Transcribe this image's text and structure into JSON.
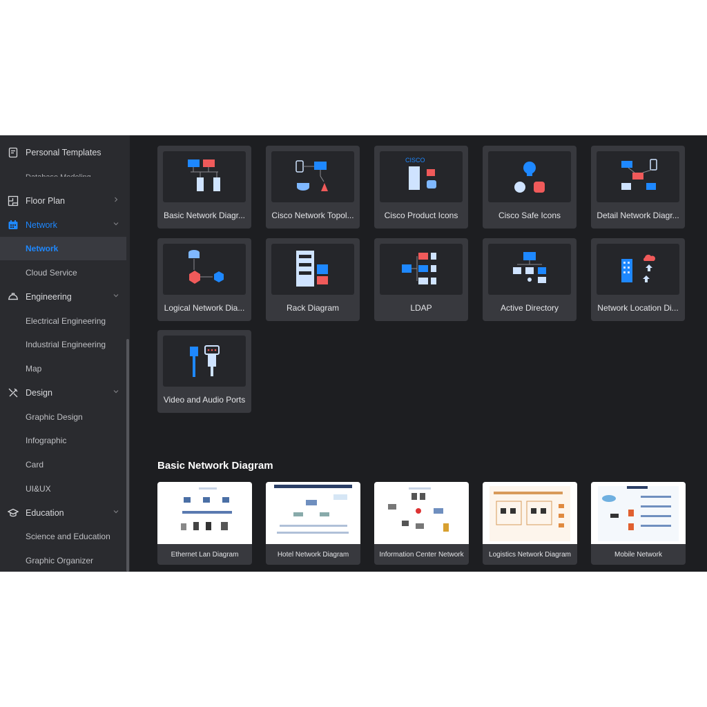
{
  "colors": {
    "accent": "#1e88ff",
    "sidebar_bg": "#2a2b2f",
    "content_bg": "#1d1e21",
    "card_bg": "#38393e"
  },
  "sidebar": {
    "personal_templates": "Personal Templates",
    "clipped_item": "Database Modeling",
    "items": [
      {
        "label": "Floor Plan",
        "icon": "floor-plan-icon"
      },
      {
        "label": "Network",
        "icon": "network-icon"
      },
      {
        "label": "Network"
      },
      {
        "label": "Cloud Service"
      },
      {
        "label": "Engineering",
        "icon": "helmet-icon"
      },
      {
        "label": "Electrical Engineering"
      },
      {
        "label": "Industrial Engineering"
      },
      {
        "label": "Map"
      },
      {
        "label": "Design",
        "icon": "design-tools-icon"
      },
      {
        "label": "Graphic Design"
      },
      {
        "label": "Infographic"
      },
      {
        "label": "Card"
      },
      {
        "label": "UI&UX"
      },
      {
        "label": "Education",
        "icon": "graduation-cap-icon"
      },
      {
        "label": "Science and Education"
      },
      {
        "label": "Graphic Organizer"
      }
    ]
  },
  "templates": [
    {
      "label": "Basic Network Diagr..."
    },
    {
      "label": "Cisco Network Topol..."
    },
    {
      "label": "Cisco Product Icons"
    },
    {
      "label": "Cisco Safe Icons"
    },
    {
      "label": "Detail Network Diagr..."
    },
    {
      "label": "Logical Network Dia..."
    },
    {
      "label": "Rack Diagram"
    },
    {
      "label": "LDAP"
    },
    {
      "label": "Active Directory"
    },
    {
      "label": "Network Location Di..."
    },
    {
      "label": "Video and Audio Ports"
    }
  ],
  "section": {
    "title": "Basic Network Diagram",
    "examples": [
      {
        "label": "Ethernet Lan Diagram"
      },
      {
        "label": "Hotel Network Diagram"
      },
      {
        "label": "Information Center Network"
      },
      {
        "label": "Logistics Network Diagram"
      },
      {
        "label": "Mobile Network"
      }
    ]
  },
  "cisco_logo_text": "CISCO"
}
